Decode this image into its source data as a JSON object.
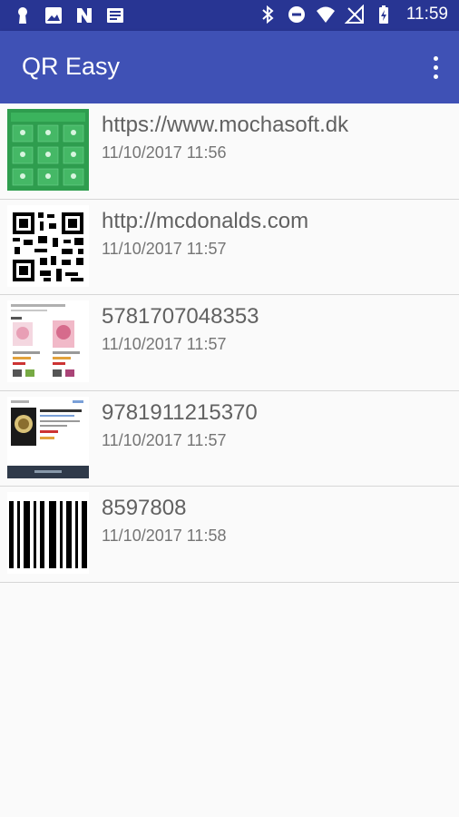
{
  "status_bar": {
    "time": "11:59",
    "left_icons": [
      "keyhole-icon",
      "image-icon",
      "n-notification-icon",
      "news-icon"
    ],
    "right_icons": [
      "bluetooth-icon",
      "do-not-disturb-icon",
      "wifi-icon",
      "no-sim-icon",
      "battery-icon"
    ]
  },
  "app_bar": {
    "title": "QR Easy",
    "overflow_icon": "more-vert-icon"
  },
  "colors": {
    "status_bar": "#283593",
    "app_bar": "#3f51b5",
    "background": "#fafafa"
  },
  "history": [
    {
      "title": "https://www.mochasoft.dk",
      "date": "11/10/2017 11:56",
      "thumbnail": "app-grid-thumbnail"
    },
    {
      "title": "http://mcdonalds.com",
      "date": "11/10/2017 11:57",
      "thumbnail": "qr-code-thumbnail"
    },
    {
      "title": "5781707048353",
      "date": "11/10/2017 11:57",
      "thumbnail": "product-page-thumbnail"
    },
    {
      "title": "9781911215370",
      "date": "11/10/2017 11:57",
      "thumbnail": "book-page-thumbnail"
    },
    {
      "title": "8597808",
      "date": "11/10/2017 11:58",
      "thumbnail": "barcode-thumbnail"
    }
  ]
}
